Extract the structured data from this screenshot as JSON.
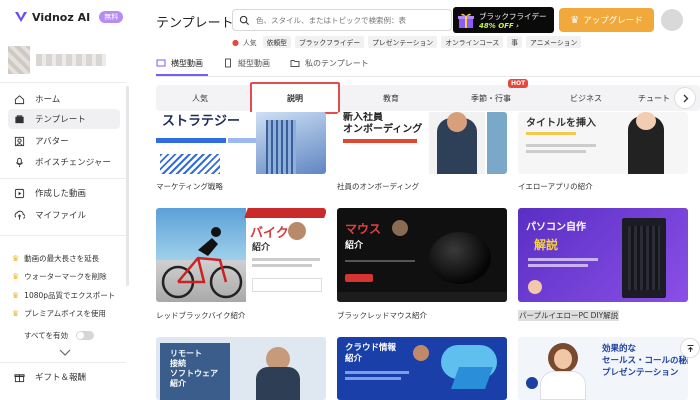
{
  "brand": {
    "name": "Vidnoz AI",
    "badge": "無料"
  },
  "sidebar": {
    "nav": [
      {
        "label": "ホーム",
        "icon": "home-icon"
      },
      {
        "label": "テンプレート",
        "icon": "template-icon",
        "active": true
      },
      {
        "label": "アバター",
        "icon": "avatar-icon"
      },
      {
        "label": "ボイスチェンジャー",
        "icon": "voice-changer-icon"
      },
      {
        "label": "作成した動画",
        "icon": "video-icon"
      },
      {
        "label": "マイファイル",
        "icon": "upload-icon"
      }
    ],
    "perks": [
      "動画の最大長さを延長",
      "ウォーターマークを削除",
      "1080p品質でエクスポート",
      "プレミアムボイスを使用"
    ],
    "enable_all": "すべてを有効",
    "gift": "ギフト＆報酬"
  },
  "header": {
    "title": "テンプレート",
    "search_placeholder": "色、スタイル、またはトピックで検索例：表",
    "promo_title": "ブラックフライデー",
    "promo_sub": "48% OFF ›",
    "upgrade": "アップグレード"
  },
  "trending": {
    "label": "人気",
    "tags": [
      "依頼型",
      "ブラックフライデー",
      "プレゼンテーション",
      "オンラインコース",
      "事",
      "アニメーション"
    ]
  },
  "tabs": [
    {
      "label": "横型動画",
      "active": true
    },
    {
      "label": "縦型動画"
    },
    {
      "label": "私のテンプレート"
    }
  ],
  "categories": [
    {
      "label": "人気"
    },
    {
      "label": "説明",
      "selected": true
    },
    {
      "label": "教育"
    },
    {
      "label": "季節・行事",
      "hot": "HOT"
    },
    {
      "label": "ビジネス"
    },
    {
      "label": "チュート"
    }
  ],
  "cards": [
    {
      "caption": "マーケティング戦略",
      "title": "ストラテジー"
    },
    {
      "caption": "社員のオンボーディング",
      "title": "新入社員\nオンボーディング"
    },
    {
      "caption": "イエローアプリの紹介",
      "title": "タイトルを挿入"
    },
    {
      "caption": "レッドブラックバイク紹介",
      "title": "バイク",
      "sub": "紹介"
    },
    {
      "caption": "ブラックレッドマウス紹介",
      "title": "マウス",
      "sub": "紹介"
    },
    {
      "caption": "パープルイエローPC DIY解説",
      "title": "パソコン自作",
      "sub": "解説"
    },
    {
      "caption": "",
      "title": "リモート\n接続\nソフトウェア\n紹介"
    },
    {
      "caption": "",
      "title": "クラウド情報\n紹介"
    },
    {
      "caption": "",
      "title": "効果的な\nセールス・コールの秘訣\nプレゼンテーション"
    }
  ]
}
